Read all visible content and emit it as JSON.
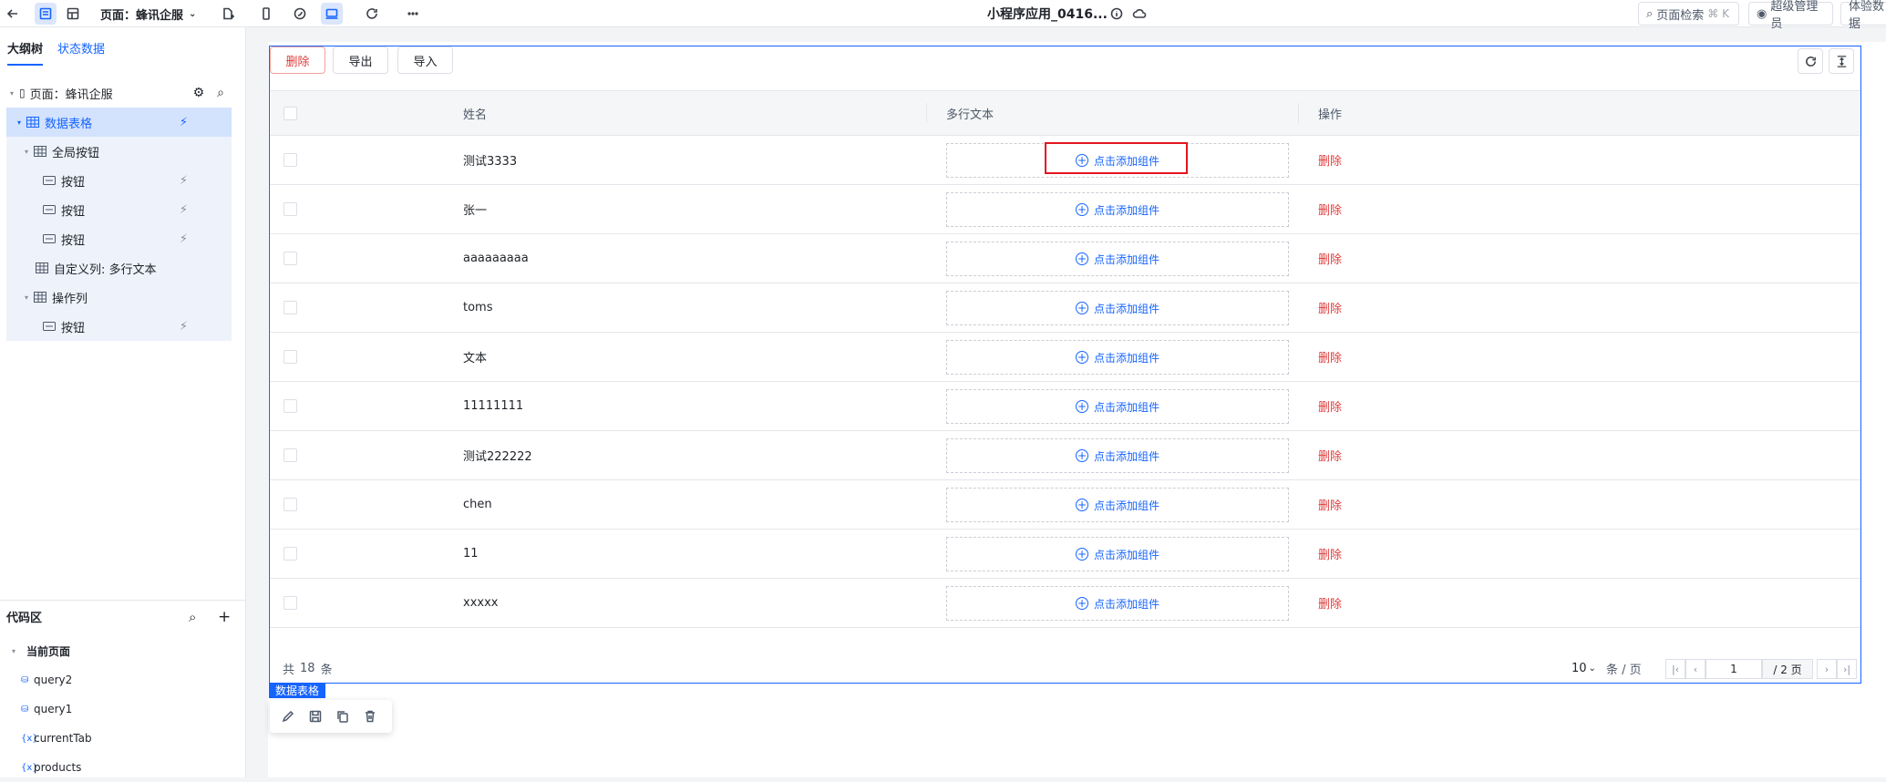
{
  "topbar": {
    "page_selector": "页面：蜂讯企服",
    "app_title": "小程序应用_0416...",
    "search_label": "页面检索",
    "search_shortcut": "⌘ K",
    "user_label": "超级管理员",
    "trial_label": "体验数据"
  },
  "left_panel": {
    "tabs": [
      "大纲树",
      "状态数据"
    ],
    "tree": [
      {
        "label": "页面：蜂讯企服",
        "level": 0
      },
      {
        "label": "数据表格",
        "level": 1
      },
      {
        "label": "全局按钮",
        "level": 2
      },
      {
        "label": "按钮",
        "level": 3
      },
      {
        "label": "按钮",
        "level": 3
      },
      {
        "label": "按钮",
        "level": 3
      },
      {
        "label": "自定义列: 多行文本",
        "level": 2
      },
      {
        "label": "操作列",
        "level": 2
      },
      {
        "label": "按钮",
        "level": 3
      }
    ],
    "code_area_title": "代码区",
    "current_page_label": "当前页面",
    "code_items": [
      {
        "label": "query2",
        "icon": "database-icon"
      },
      {
        "label": "query1",
        "icon": "database-icon"
      },
      {
        "label": "currentTab",
        "icon": "variable-icon"
      },
      {
        "label": "products",
        "icon": "variable-icon"
      }
    ]
  },
  "table": {
    "toolbar": {
      "delete": "删除",
      "export": "导出",
      "import": "导入"
    },
    "columns": [
      "姓名",
      "多行文本",
      "操作"
    ],
    "add_component_label": "点击添加组件",
    "row_action": "删除",
    "rows": [
      "测试3333",
      "张一",
      "aaaaaaaaa",
      "toms",
      "文本",
      "11111111",
      "测试222222",
      "chen",
      "11",
      "xxxxx"
    ],
    "pager": {
      "total_prefix": "共",
      "total": "18",
      "total_suffix": "条",
      "page_size": "10",
      "page_size_unit": "条 / 页",
      "current_page": "1",
      "total_pages": "/ 2 页"
    },
    "component_tag": "数据表格"
  }
}
